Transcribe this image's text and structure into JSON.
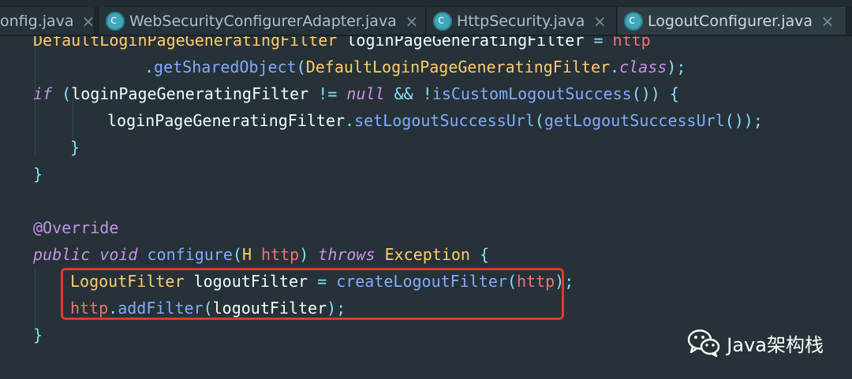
{
  "tabs": [
    {
      "label": "onfig.java",
      "active": false,
      "icon": "java-class-icon"
    },
    {
      "label": "WebSecurityConfigurerAdapter.java",
      "active": false,
      "icon": "java-class-icon"
    },
    {
      "label": "HttpSecurity.java",
      "active": false,
      "icon": "java-class-icon"
    },
    {
      "label": "LogoutConfigurer.java",
      "active": true,
      "icon": "java-class-icon"
    }
  ],
  "close_glyph": "×",
  "code": {
    "lines": [
      "DefaultLoginPageGeneratingFilter loginPageGeneratingFilter = http",
      ".getSharedObject(DefaultLoginPageGeneratingFilter.class);",
      "if (loginPageGeneratingFilter != null && !isCustomLogoutSuccess()) {",
      "loginPageGeneratingFilter.setLogoutSuccessUrl(getLogoutSuccessUrl());",
      "}",
      "}",
      "",
      "@Override",
      "public void configure(H http) throws Exception {",
      "LogoutFilter logoutFilter = createLogoutFilter(http);",
      "http.addFilter(logoutFilter);",
      "}"
    ]
  },
  "watermark": {
    "text": "Java架构栈",
    "icon": "wechat-icon"
  },
  "colors": {
    "background": "#263238",
    "keyword": "#c792ea",
    "class": "#ffcb6b",
    "function": "#82aaff",
    "highlight": "#e0392b"
  }
}
